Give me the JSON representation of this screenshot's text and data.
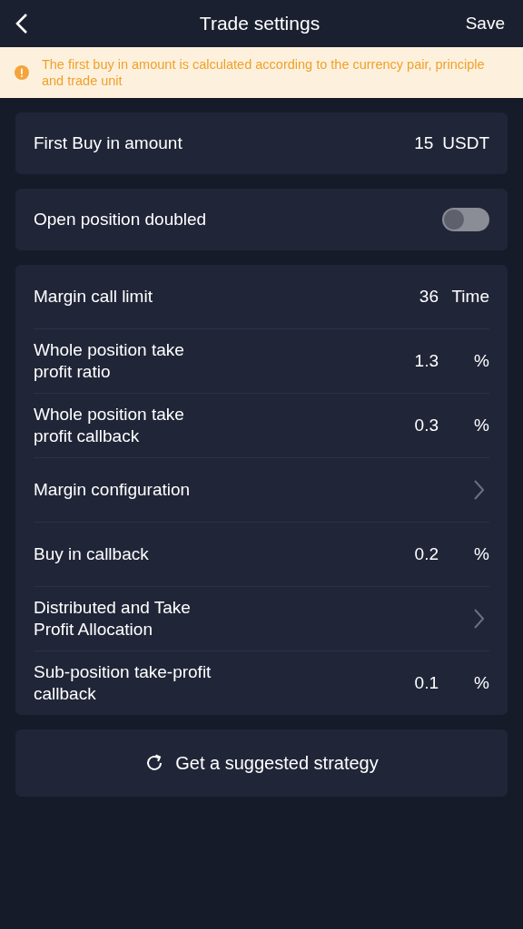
{
  "header": {
    "title": "Trade settings",
    "save": "Save"
  },
  "notice": {
    "text": "The first buy in amount is calculated according to the currency pair, principle and trade unit"
  },
  "first_buy": {
    "label": "First Buy in amount",
    "value": "15",
    "unit": "USDT"
  },
  "doubled": {
    "label": "Open position doubled",
    "on": false
  },
  "settings": [
    {
      "kind": "value",
      "label": "Margin call limit",
      "value": "36",
      "unit": "Time"
    },
    {
      "kind": "value",
      "label": "Whole position take profit ratio",
      "value": "1.3",
      "unit": "%"
    },
    {
      "kind": "value",
      "label": "Whole position take profit callback",
      "value": "0.3",
      "unit": "%"
    },
    {
      "kind": "link",
      "label": "Margin configuration"
    },
    {
      "kind": "value",
      "label": "Buy in callback",
      "value": "0.2",
      "unit": "%"
    },
    {
      "kind": "link",
      "label": "Distributed and Take Profit Allocation"
    },
    {
      "kind": "value",
      "label": "Sub-position take-profit callback",
      "value": "0.1",
      "unit": "%"
    }
  ],
  "suggest": {
    "label": "Get a suggested strategy"
  }
}
